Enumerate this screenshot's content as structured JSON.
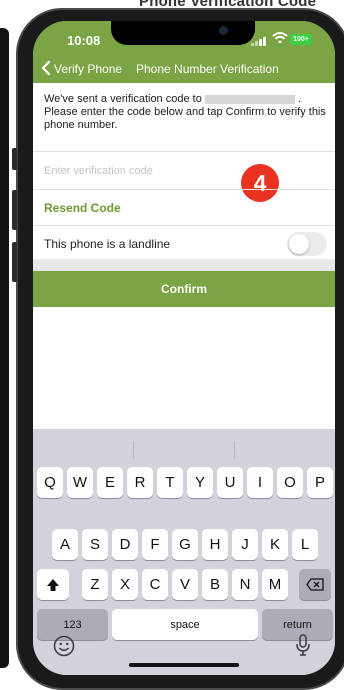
{
  "background": {
    "doc_title": "Phone Verification Code"
  },
  "status_bar": {
    "time": "10:08",
    "battery_label": "100+",
    "battery_color": "#39d043"
  },
  "nav_bar": {
    "back_label": "Verify Phone",
    "title": "Phone Number Verification",
    "color": "#7ba544"
  },
  "message": {
    "before": "We've sent a verification code to",
    "after": ". Please enter the code below and tap Confirm to verify this phone number."
  },
  "code_field": {
    "placeholder": "Enter verification code",
    "value": ""
  },
  "step_badge": {
    "label": "4",
    "color": "#e9321f"
  },
  "resend": {
    "label": "Resend Code"
  },
  "landline": {
    "label": "This phone is a landline",
    "enabled": false
  },
  "confirm": {
    "label": "Confirm"
  },
  "keyboard": {
    "row1": [
      "Q",
      "W",
      "E",
      "R",
      "T",
      "Y",
      "U",
      "I",
      "O",
      "P"
    ],
    "row2": [
      "A",
      "S",
      "D",
      "F",
      "G",
      "H",
      "J",
      "K",
      "L"
    ],
    "row3": [
      "Z",
      "X",
      "C",
      "V",
      "B",
      "N",
      "M"
    ],
    "numbers_key": "123",
    "space_key": "space",
    "return_key": "return"
  },
  "icons": [
    "back-chevron",
    "wifi",
    "battery",
    "shift-arrow",
    "backspace",
    "emoji",
    "microphone"
  ]
}
